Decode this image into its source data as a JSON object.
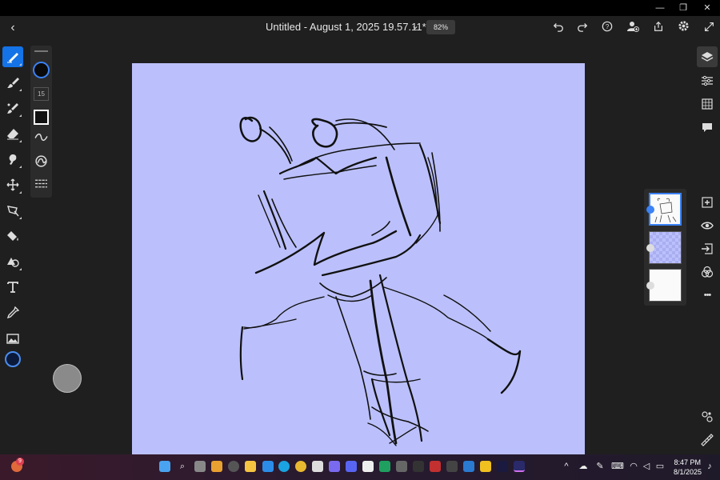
{
  "window": {
    "minimize_glyph": "—",
    "restore_glyph": "❐",
    "close_glyph": "✕"
  },
  "header": {
    "back_glyph": "‹",
    "document_title": "Untitled - August 1, 2025 19.57.11*",
    "title_chevron": "⌄",
    "zoom_level": "82%",
    "icons": [
      "undo-icon",
      "redo-icon",
      "help-icon",
      "invite-user-icon",
      "share-icon",
      "settings-icon",
      "fullscreen-icon"
    ]
  },
  "left_toolbar": {
    "tools": [
      "pixel-brush",
      "paint-brush",
      "vector-brush",
      "eraser",
      "smudge",
      "move-transform",
      "selection",
      "fill",
      "shapes",
      "text",
      "eyedropper",
      "image"
    ],
    "active_tool": "pixel-brush",
    "current_color": "#0b1a3a"
  },
  "brush_panel": {
    "brush_color": "#0a0a0a",
    "brush_size": "15",
    "opacity_color": "#111111"
  },
  "canvas": {
    "background_color": "#bbc0fc",
    "stroke_color": "#111111"
  },
  "right_toolbar": {
    "icons": [
      "layers-icon",
      "properties-icon",
      "grid-icon",
      "comments-icon",
      "add-layer-icon",
      "visibility-icon",
      "import-icon",
      "blend-icon",
      "more-icon",
      "touch-shortcut-icon",
      "ruler-icon"
    ],
    "more_glyph": "•••"
  },
  "layers": {
    "items": [
      {
        "kind": "sketch",
        "selected": true
      },
      {
        "kind": "transparent",
        "selected": false
      },
      {
        "kind": "background",
        "selected": false
      }
    ]
  },
  "taskbar": {
    "notification_count": "9",
    "clock_time": "8:47 PM",
    "clock_date": "8/1/2025",
    "chevron_glyph": "^"
  }
}
